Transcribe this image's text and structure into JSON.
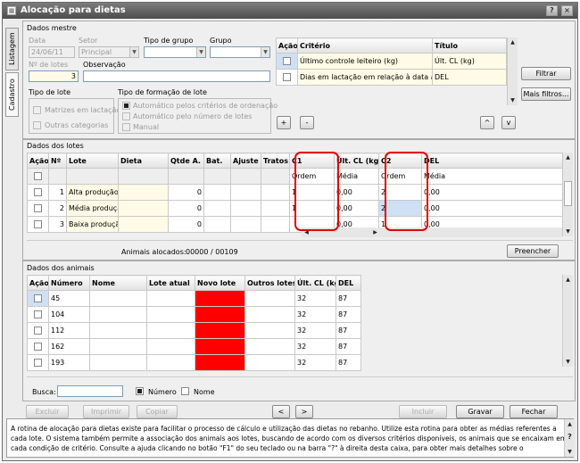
{
  "window": {
    "title": "Alocação para dietas",
    "help_label": "?",
    "close_label": "×"
  },
  "tabs": [
    {
      "label": "Listagem"
    },
    {
      "label": "Cadastro"
    }
  ],
  "master": {
    "section_title": "Dados mestre",
    "data_label": "Data",
    "data_value": "24/06/11",
    "setor_label": "Setor",
    "setor_value": "Principal",
    "tipo_grupo_label": "Tipo de grupo",
    "grupo_label": "Grupo",
    "num_lotes_label": "Nº de lotes",
    "num_lotes_value": "3",
    "observacao_label": "Observação",
    "tipo_lote_label": "Tipo de lote",
    "tipo_lote_options": [
      "Matrizes em lactação",
      "Outras categorias"
    ],
    "tipo_formacao_label": "Tipo de formação de lote",
    "tipo_formacao_options": [
      "Automático pelos critérios de ordenação",
      "Automático pelo número de lotes",
      "Manual"
    ]
  },
  "criteria": {
    "headers": [
      "Ação",
      "Critério",
      "Título"
    ],
    "rows": [
      {
        "criterio": "Último controle leiteiro (kg)",
        "titulo": "Últ. CL (kg)"
      },
      {
        "criterio": "Dias em lactação em relação à data atual",
        "titulo": "DEL"
      }
    ],
    "add_label": "+",
    "remove_label": "-",
    "up_label": "^",
    "down_label": "v",
    "filtrar_label": "Filtrar",
    "mais_filtros_label": "Mais filtros..."
  },
  "lotes": {
    "section_title": "Dados dos lotes",
    "headers": [
      "Ação",
      "Nº",
      "Lote",
      "Dieta",
      "Qtde A.",
      "Bat.",
      "Ajuste",
      "Tratos",
      "C1",
      "Últ. CL (kg",
      "C2",
      "DEL"
    ],
    "subheaders": {
      "c1": "Ordem",
      "ultcl": "Média",
      "c2": "Ordem",
      "del": "Média"
    },
    "rows": [
      {
        "num": "1",
        "lote": "Alta produção",
        "qtde": "0",
        "c1": "1",
        "ultcl": "0,00",
        "c2": "2",
        "del": "0,00"
      },
      {
        "num": "2",
        "lote": "Média produção",
        "qtde": "0",
        "c1": "1",
        "ultcl": "0,00",
        "c2": "2",
        "del": "0,00"
      },
      {
        "num": "3",
        "lote": "Baixa produção",
        "qtde": "0",
        "c1": "",
        "ultcl": "0,00",
        "c2": "1",
        "del": "0,00"
      }
    ],
    "alocados_label": "Animais alocados:",
    "alocados_value": "00000 / 00109",
    "preencher_label": "Preencher"
  },
  "animais": {
    "section_title": "Dados dos animais",
    "headers": [
      "Ação",
      "Número",
      "Nome",
      "Lote atual",
      "Novo lote",
      "Outros lotes",
      "Últ. CL (kg",
      "DEL"
    ],
    "rows": [
      {
        "numero": "45",
        "ultcl": "32",
        "del": "87"
      },
      {
        "numero": "104",
        "ultcl": "32",
        "del": "87"
      },
      {
        "numero": "112",
        "ultcl": "32",
        "del": "87"
      },
      {
        "numero": "162",
        "ultcl": "32",
        "del": "87"
      },
      {
        "numero": "193",
        "ultcl": "32",
        "del": "87"
      }
    ],
    "busca_label": "Busca:",
    "numero_option": "Número",
    "nome_option": "Nome"
  },
  "toolbar": {
    "excluir": "Excluir",
    "imprimir": "Imprimir",
    "copiar": "Copiar",
    "prev": "<",
    "next": ">",
    "incluir": "Incluir",
    "gravar": "Gravar",
    "fechar": "Fechar"
  },
  "description": "A rotina de alocação para dietas existe para facilitar o processo de cálculo e utilização das dietas no rebanho. Utilize esta rotina para obter as médias referentes a cada lote. O sistema também permite a associação dos animais aos lotes, buscando de acordo com os diversos critérios disponíveis, os animais que se encaixam em cada condição de critério. Consulte a ajuda clicando no botão \"F1\" do seu teclado ou na barra \"?\" à direita desta caixa, para obter mais detalhes sobre o",
  "colors": {
    "accent_red": "#e00000",
    "novo_lote_fill": "#ff0000",
    "titlebar": "#5a5a5a"
  }
}
